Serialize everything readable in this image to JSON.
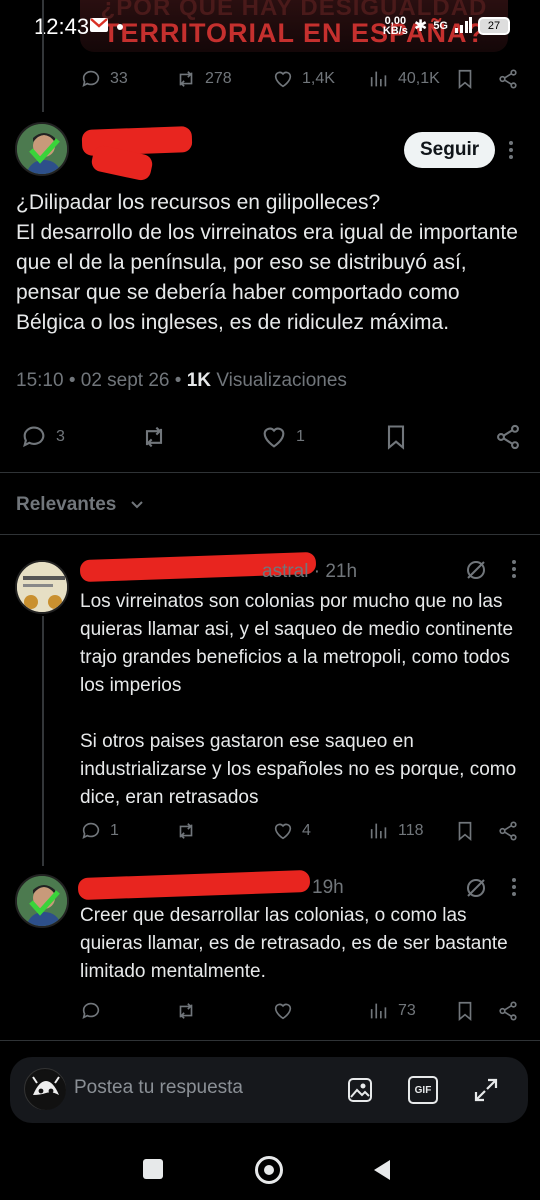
{
  "status_bar": {
    "time": "12:43",
    "banner_line1": "¿POR QUÉ HAY DESIGUALDAD",
    "banner_line2": "TERRITORIAL EN ESPAÑA?",
    "net_speed_value": "0,00",
    "net_speed_unit": "KB/s",
    "network": "5G",
    "battery": "27"
  },
  "top_actions": {
    "replies": "33",
    "retweets": "278",
    "likes": "1,4K",
    "views": "40,1K"
  },
  "main_post": {
    "follow_label": "Seguir",
    "text": "¿Dilipadar los recursos en gilipolleces?\nEl desarrollo de los virreinatos era igual de importante que el de la península, por eso se distribuyó así, pensar que se debería haber comportado como Bélgica o los ingleses, es de ridiculez máxima.",
    "time": "15:10",
    "date": "02 sept 26",
    "views_count": "1K",
    "views_label": "Visualizaciones",
    "replies": "3",
    "likes": "1"
  },
  "sort": {
    "label": "Relevantes"
  },
  "replies": [
    {
      "handle_tail": "astral",
      "time": "21h",
      "text": "Los virreinatos son colonias por mucho que no las quieras llamar asi, y el saqueo de medio continente trajo grandes beneficios a la metropoli, como todos los imperios\n\nSi otros paises gastaron ese saqueo en industrializarse y los españoles no es porque, como dice, eran retrasados",
      "replies": "1",
      "likes": "4",
      "views": "118"
    },
    {
      "time": "19h",
      "text": "Creer que desarrollar las colonias, o como las quieras llamar, es de retrasado, es de ser bastante limitado mentalmente.",
      "views": "73"
    }
  ],
  "composer": {
    "placeholder": "Postea tu respuesta",
    "gif_label": "GIF"
  },
  "colors": {
    "background": "#000000",
    "text": "#e7e9ea",
    "muted": "#71767b",
    "redaction": "#e8251f",
    "banner_red": "#c5302e"
  }
}
